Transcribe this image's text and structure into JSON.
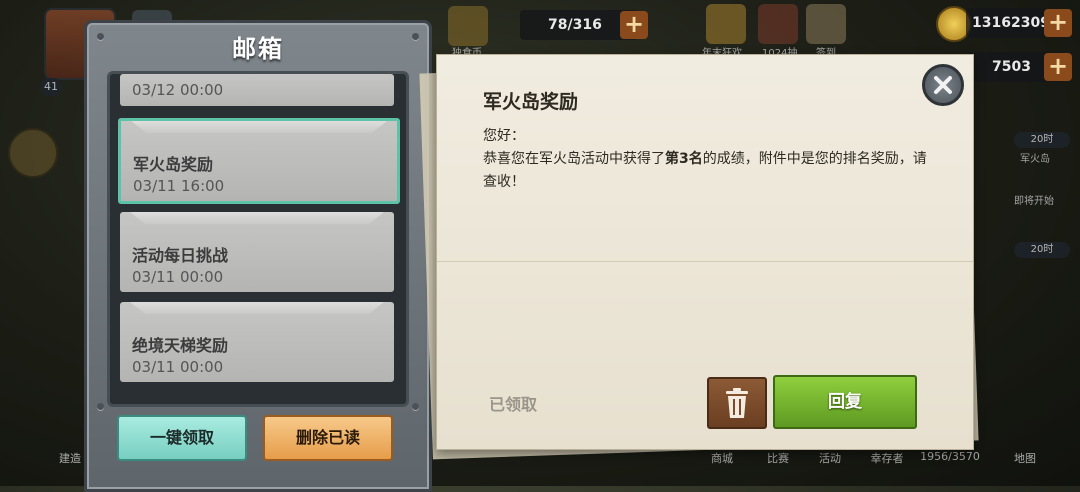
{
  "hud": {
    "level": "41",
    "energy": "78/316",
    "coins": "13162309",
    "gems": "7503",
    "small_labels": [
      "独食币",
      "年末狂欢",
      "1024抽",
      "签到"
    ],
    "right_timers": [
      "20时",
      "20时"
    ],
    "right_labels": [
      "军火岛",
      "即将开始"
    ],
    "bottom_labels": [
      "建造",
      "商城",
      "比赛",
      "活动",
      "幸存者",
      "1956/3570",
      "地图"
    ]
  },
  "mailbox": {
    "title": "邮箱",
    "items": [
      {
        "title": "",
        "time": "03/12 00:00"
      },
      {
        "title": "军火岛奖励",
        "time": "03/11 16:00"
      },
      {
        "title": "活动每日挑战",
        "time": "03/11 00:00"
      },
      {
        "title": "绝境天梯奖励",
        "time": "03/11 00:00"
      }
    ],
    "claim_all_label": "一键领取",
    "delete_read_label": "删除已读"
  },
  "letter": {
    "title": "军火岛奖励",
    "greeting": "您好：",
    "body_prefix": "恭喜您在军火岛活动中获得了",
    "rank": "第3名",
    "body_suffix": "的成绩，附件中是您的排名奖励，请查收！",
    "claimed_label": "已领取",
    "reply_label": "回复"
  },
  "colors": {
    "selected_border": "#5cc3a8",
    "claim_all": "#77cfc1",
    "delete_read": "#e69d4a",
    "reply": "#6fae2c",
    "trash": "#7a4a2a"
  }
}
